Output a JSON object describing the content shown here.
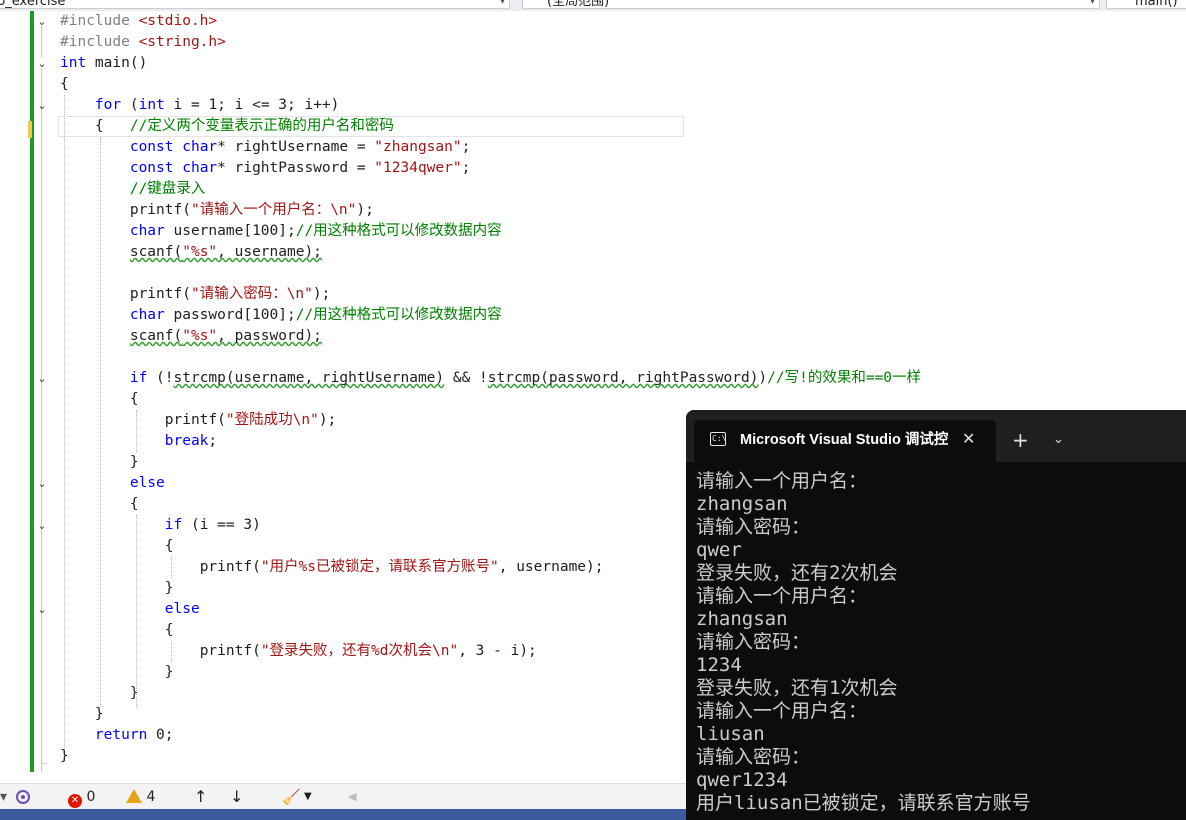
{
  "nav": {
    "project_dropdown": "b_exercise",
    "scope_dropdown": "(全局范围)",
    "member_dropdown": "main()"
  },
  "code": {
    "l1_pp": "#include",
    "l1_hdr": "<stdio.h>",
    "l2_pp": "#include",
    "l2_hdr": "<string.h>",
    "l3_kw": "int",
    "l3_rest": " main()",
    "l4": "{",
    "l5_kw": "for",
    "l5_a": " (",
    "l5_kw2": "int",
    "l5_b": " i = 1; i <= 3; i++)",
    "l6_brace": "{",
    "l6_cm": "//定义两个变量表示正确的用户名和密码",
    "l7_kw": "const",
    "l7_kw2": "char",
    "l7_rest": "* rightUsername = ",
    "l7_str": "\"zhangsan\"",
    "l7_end": ";",
    "l8_kw": "const",
    "l8_kw2": "char",
    "l8_rest": "* rightPassword = ",
    "l8_str": "\"1234qwer\"",
    "l8_end": ";",
    "l9_cm": "//键盘录入",
    "l10_fn": "printf",
    "l10_str": "\"请输入一个用户名：",
    "l10_esc": "\\n",
    "l10_str2": "\"",
    "l10_end": ");",
    "l11_kw": "char",
    "l11_rest": " username[100];",
    "l11_cm": "//用这种格式可以修改数据内容",
    "l12_text": "scanf(",
    "l12_str": "\"%s\"",
    "l12_rest": ", username);",
    "l14_fn": "printf",
    "l14_str": "\"请输入密码：",
    "l14_esc": "\\n",
    "l14_str2": "\"",
    "l14_end": ");",
    "l15_kw": "char",
    "l15_rest": " password[100];",
    "l15_cm": "//用这种格式可以修改数据内容",
    "l16_text": "scanf(",
    "l16_str": "\"%s\"",
    "l16_rest": ", password);",
    "l18_kw": "if",
    "l18_a": " (!",
    "l18_sq": "strcmp(username, rightUsername)",
    "l18_b": " && !",
    "l18_sq2": "strcmp(password, rightPassword)",
    "l18_c": ")",
    "l18_cm": "//写!的效果和==0一样",
    "l19": "{",
    "l20_fn": "printf",
    "l20_str": "\"登陆成功",
    "l20_esc": "\\n",
    "l20_str2": "\"",
    "l20_end": ");",
    "l21_kw": "break",
    "l21_end": ";",
    "l22": "}",
    "l23_kw": "else",
    "l24": "{",
    "l25_kw": "if",
    "l25_rest": " (i == 3)",
    "l26": "{",
    "l27_fn": "printf",
    "l27_str": "\"用户%s已被锁定，请联系官方账号\"",
    "l27_rest": ", username);",
    "l28": "}",
    "l29_kw": "else",
    "l30": "{",
    "l31_fn": "printf",
    "l31_str": "\"登录失败，还有%d次机会",
    "l31_esc": "\\n",
    "l31_str2": "\"",
    "l31_rest": ", 3 - i);",
    "l32": "}",
    "l33": "}",
    "l34": "}",
    "l35_kw": "return",
    "l35_rest": " 0;",
    "l36": "}"
  },
  "status": {
    "errors": "0",
    "warnings": "4"
  },
  "terminal": {
    "tab_title": "Microsoft Visual Studio 调试控制台",
    "output": [
      "请输入一个用户名：",
      "zhangsan",
      "请输入密码：",
      "qwer",
      "登录失败，还有2次机会",
      "请输入一个用户名：",
      "zhangsan",
      "请输入密码：",
      "1234",
      "登录失败，还有1次机会",
      "请输入一个用户名：",
      "liusan",
      "请输入密码：",
      "qwer1234",
      "用户liusan已被锁定，请联系官方账号"
    ]
  },
  "colors": {
    "keyword": "#0000ff",
    "string": "#a31515",
    "comment": "#008000",
    "preprocessor": "#808080",
    "change_bar": "#1e9a2c",
    "terminal_bg": "#0c0c0c"
  }
}
